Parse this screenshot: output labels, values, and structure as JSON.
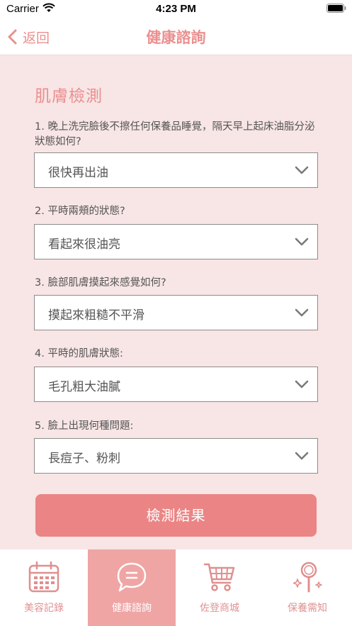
{
  "status": {
    "carrier": "Carrier",
    "time": "4:23 PM"
  },
  "nav": {
    "back_label": "返回",
    "title": "健康諮詢"
  },
  "section_title": "肌膚檢測",
  "questions": [
    {
      "label": "1. 晚上洗完臉後不擦任何保養品睡覺，隔天早上起床油脂分泌狀態如何?",
      "value": "很快再出油"
    },
    {
      "label": "2. 平時兩頰的狀態?",
      "value": "看起來很油亮"
    },
    {
      "label": "3. 臉部肌膚摸起來感覺如何?",
      "value": "摸起來粗糙不平滑"
    },
    {
      "label": "4. 平時的肌膚狀態:",
      "value": "毛孔粗大油膩"
    },
    {
      "label": "5. 臉上出現何種問題:",
      "value": "長痘子、粉刺"
    }
  ],
  "submit_label": "檢測結果",
  "tabs": [
    {
      "label": "美容記錄",
      "icon": "calendar-icon",
      "active": false
    },
    {
      "label": "健康諮詢",
      "icon": "chat-bubble-icon",
      "active": true
    },
    {
      "label": "佐登商城",
      "icon": "shopping-cart-icon",
      "active": false
    },
    {
      "label": "保養需知",
      "icon": "hand-mirror-icon",
      "active": false
    }
  ],
  "colors": {
    "accent": "#eb8f8f",
    "background": "#f8e5e5",
    "button": "#eb8585",
    "active_tab": "#f0a5a5"
  }
}
